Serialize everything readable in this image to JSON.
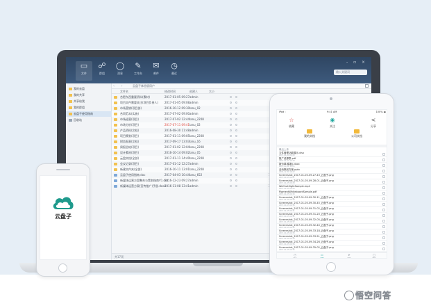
{
  "colors": {
    "header": "#2f4662",
    "accent": "#23a8a0",
    "folder": "#f2c14e",
    "date_red": "#e0443a"
  },
  "desktop": {
    "header_buttons": [
      {
        "icon": "folder-icon",
        "glyph": "▭",
        "label": "文件"
      },
      {
        "icon": "group-icon",
        "glyph": "☍",
        "label": "群组"
      },
      {
        "icon": "chat-icon",
        "glyph": "◯",
        "label": "消息"
      },
      {
        "icon": "task-icon",
        "glyph": "✎",
        "label": "工作台"
      },
      {
        "icon": "mail-icon",
        "glyph": "✉",
        "label": "邮件"
      },
      {
        "icon": "clock-icon",
        "glyph": "◷",
        "label": "最近"
      }
    ],
    "search_placeholder": "输入关键词",
    "window_controls": "- ▫ ×",
    "breadcrumb": "云盘子体验版用户",
    "nav_arrows": "‹ ›",
    "sidebar": [
      {
        "label": "我的云盘"
      },
      {
        "label": "我的共享"
      },
      {
        "label": "共享给我"
      },
      {
        "label": "我的群组"
      },
      {
        "label": "云盘子使用指南"
      },
      {
        "label": "回收站"
      }
    ],
    "columns": [
      "文件名",
      "修改时间",
      "创建人",
      "大小"
    ],
    "files": [
      {
        "name": "合肥东西重要资料(素材)",
        "date": "2017-01-05 09:27",
        "user": "admin",
        "size": "",
        "type": "folder",
        "red": false
      },
      {
        "name": "项目文件需要关注(项目负责人)",
        "date": "2017-01-05 09:08",
        "user": "admin",
        "size": "",
        "type": "folder",
        "red": false
      },
      {
        "name": "市场营销(项目部)",
        "date": "2016-10-12 09:30",
        "user": "lanu_02",
        "size": "",
        "type": "folder",
        "red": false
      },
      {
        "name": "合同范本(实施)",
        "date": "2017-07-02 09:00",
        "user": "admin",
        "size": "",
        "type": "folder",
        "red": false
      },
      {
        "name": "市场经营(项目)",
        "date": "2017-07-02 12:44",
        "user": "lanu_2208",
        "size": "",
        "type": "folder",
        "red": false
      },
      {
        "name": "市场分析(项目)",
        "date": "2017-07-11 09:41",
        "user": "lanu_02",
        "size": "",
        "type": "folder",
        "red": true
      },
      {
        "name": "产品资料(文档)",
        "date": "2016-08-30 11:48",
        "user": "admin",
        "size": "",
        "type": "folder",
        "red": false
      },
      {
        "name": "项目策划(项目)",
        "date": "2017-01-11 09:05",
        "user": "lanu_2208",
        "size": "",
        "type": "folder",
        "red": false
      },
      {
        "name": "财务报表(文档)",
        "date": "2017-09-17 13:03",
        "user": "lanu_16",
        "size": "",
        "type": "folder",
        "red": false
      },
      {
        "name": "周报总结(项目)",
        "date": "2017-01-02 12:04",
        "user": "lanu_2208",
        "size": "",
        "type": "folder",
        "red": false
      },
      {
        "name": "设计素材(项目)",
        "date": "2016-10-14 09:02",
        "user": "lanu_05",
        "size": "",
        "type": "folder",
        "red": false
      },
      {
        "name": "云盘文档(全部)",
        "date": "2017-01-11 14:40",
        "user": "lanu_2208",
        "size": "",
        "type": "folder",
        "red": false
      },
      {
        "name": "会议记录(项目)",
        "date": "2017-01-12 12:27",
        "user": "admin",
        "size": "",
        "type": "folder",
        "red": false
      },
      {
        "name": "新建文件夹(全部)",
        "date": "2016-10-11 13:01",
        "user": "lanu_2208",
        "size": "",
        "type": "folder",
        "red": false
      },
      {
        "name": "云盘子使用指南.doc",
        "date": "2017-04-03 10:44",
        "user": "lanu_652",
        "size": "1617 KB",
        "type": "doc",
        "red": false
      },
      {
        "name": "新媒体运营方案整合与策划指南V1.doc",
        "date": "2016-12-23 09:27",
        "user": "admin",
        "size": "75 KB",
        "type": "doc",
        "red": false
      },
      {
        "name": "新媒体运营方案(宣传推广)手册.docx",
        "date": "2016-11-08 13:41",
        "user": "admin",
        "size": "349 KB",
        "type": "doc",
        "red": false
      }
    ],
    "status_text": "共17项"
  },
  "tablet": {
    "status": {
      "left": "iPad ◦",
      "center": "9:41 AM",
      "right": "100% ▬"
    },
    "actions": [
      {
        "icon": "star-icon",
        "glyph": "☆",
        "label": "收藏"
      },
      {
        "icon": "eye-icon",
        "glyph": "◉",
        "label": "关注"
      },
      {
        "icon": "share-icon",
        "glyph": "<",
        "label": "分享"
      }
    ],
    "folders": [
      {
        "label": "我的文档"
      },
      {
        "label": "公司文档"
      }
    ],
    "subtitle": "最近上传",
    "files": [
      {
        "name": "文件管理功能展示.xlsx",
        "meta": "2017-01-04 09:20"
      },
      {
        "name": "推广资源表.pdf",
        "meta": "2017-01-03 14:10"
      },
      {
        "name": "报价单(模板).docx",
        "meta": "2017-01-02 11:05"
      },
      {
        "name": "活动策划方案.pptx",
        "meta": "2016-12-30 16:22"
      },
      {
        "name": "Screenshot_2017-01-05-09-27-43_云盘子.png",
        "meta": "2017-01-05 09:27"
      },
      {
        "name": "Screenshot_2017-01-05-09-28-01_云盘子.png",
        "meta": "2017-01-05 09:28"
      },
      {
        "name": "WeChatSightSample.mp4",
        "meta": "2017-01-05 09:29"
      },
      {
        "name": "PigmentWhiteboardSample.pdf",
        "meta": "2017-01-05 09:30"
      },
      {
        "name": "Screenshot_2017-01-05-09-30-11_云盘子.png",
        "meta": "2017-01-05 09:30"
      },
      {
        "name": "Screenshot_2017-01-05-09-30-45_云盘子.png",
        "meta": "2017-01-05 09:30"
      },
      {
        "name": "Screenshot_2017-01-05-09-31-02_云盘子.png",
        "meta": "2017-01-05 09:31"
      },
      {
        "name": "Screenshot_2017-01-05-09-31-20_云盘子.png",
        "meta": "2017-01-05 09:31"
      },
      {
        "name": "Screenshot_2017-01-05-09-32-05_云盘子.png",
        "meta": "2017-01-05 09:32"
      },
      {
        "name": "Screenshot_2017-01-05-09-32-40_云盘子.png",
        "meta": "2017-01-05 09:32"
      },
      {
        "name": "Screenshot_2017-01-05-09-33-18_云盘子.png",
        "meta": "2017-01-05 09:33"
      },
      {
        "name": "Screenshot_2017-01-05-09-33-51_云盘子.png",
        "meta": "2017-01-05 09:33"
      },
      {
        "name": "Screenshot_2017-01-05-09-34-26_云盘子.png",
        "meta": "2017-01-05 09:34"
      },
      {
        "name": "Screenshot_2017-01-05-09-35-02_云盘子.png",
        "meta": "2017-01-05 09:35"
      }
    ],
    "tabs": [
      {
        "icon": "recent-icon",
        "glyph": "◷",
        "label": "最近"
      },
      {
        "icon": "files-icon",
        "glyph": "▭",
        "label": "文件"
      },
      {
        "icon": "send-icon",
        "glyph": "➤",
        "label": "传输"
      },
      {
        "icon": "me-icon",
        "glyph": "◯",
        "label": "我的"
      }
    ]
  },
  "phone": {
    "app_name": "云盘子"
  },
  "watermark": {
    "text": "悟空问答"
  }
}
